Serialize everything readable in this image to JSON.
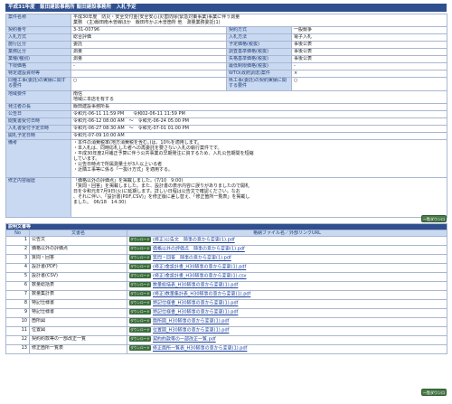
{
  "header": {
    "title": "平成31年度　飯田建設事務所 飯田建設事務所　入札予定"
  },
  "info": {
    "rows": [
      {
        "label": "案件名称",
        "value": "平成30年度　防災・安全交付金(安全安心)災害防除(緊急対策事業)事業に伴う測量\n業務　(主)飯田南木曽線ほか　飯田市かぶ木曽箇所 他　測量業務委託(1)"
      },
      {
        "label": "契約番号",
        "value": "3-31-00796",
        "label2": "契約方式",
        "value2": "一般競争"
      },
      {
        "label": "入札方式",
        "value": "総合評価",
        "label2": "入札方法",
        "value2": "電子入札"
      },
      {
        "label": "施行区分",
        "value": "委託",
        "label2": "予定価格(税抜)",
        "value2": "事後公表"
      },
      {
        "label": "業務区分",
        "value": "測量",
        "label2": "調査基準価格(税抜)",
        "value2": "事後公表"
      },
      {
        "label": "業種(種別)",
        "value": "測量",
        "label2": "失格基準価格(税抜)",
        "value2": "事後公表"
      },
      {
        "label": "下限価格",
        "value": "-",
        "label2": "最低制限価格(税抜)",
        "value2": "-"
      },
      {
        "label": "特定建設資材等",
        "value": "",
        "label2": "WTO(政府調達)案件",
        "value2": "×"
      },
      {
        "label": "同種工事(委託)の実績に関する要件",
        "value": "○",
        "label2": "県工事(委託)の契約実績に関する要件",
        "value2": "○"
      },
      {
        "label": "地域要件",
        "value": "南信\n地域に本店を有する"
      },
      {
        "label": "発注者の長",
        "value": "飯田建設事務所長"
      },
      {
        "label": "公告日",
        "value": "令和元-06-11 11:59 PM　　令和02-06-11 11:59 PM"
      },
      {
        "label": "閲覧書受付日時",
        "value": "令和元-06-12 08:00 AM　～　令和元-06-24 05:00 PM"
      },
      {
        "label": "入札書受付予定日時",
        "value": "令和元-06-27 08:30 AM　～　令和元-07-01 01:00 PM"
      },
      {
        "label": "開札予定日時",
        "value": "令和元-07-09 10:00 AM"
      },
      {
        "label": "備考",
        "value": "・本件の消費税率(地方消費税を含む。)は、10％を適用します。\n・本入札は、同時応札した者への再委託を要さない入札の執行案件です。\n・平成30年度2月補正予算に伴う公共事業の早期発注に資するため、入札公告期間を短縮\nしています。\n・公告日時点で所属測量士が3人以上いる者\n・近隣工事等に係る「一抜け方式」を適用する。"
      },
      {
        "label": "修正内容履歴",
        "value": "「価格以外の評価点」を掲載しました。(7/10　9:00)\n「質問・回答」を掲載しました。また、設計書の表示内容に誤りがありましたので開札\n日を令和元年7月9日(火)に延期します。詳しい日程は公告文で確認ください。なお\n、それに伴い、「設計書(PDF,CSV)」を修正版に差し替え、「修正箇所一覧表」を掲載し\nました。　06/18　14:30)"
      }
    ]
  },
  "docs": {
    "title": "説明文書等",
    "col_no": "No",
    "col_name": "文書名",
    "col_file": "格納ファイル名／外部リンクURL",
    "download_label": "ダウンロード",
    "top_button": "一覧ダウンロード",
    "bottom_button": "一覧ダウンロード",
    "items": [
      {
        "no": "1",
        "name": "公告文",
        "file": "(修正)公告文　随事の意から変更(1).pdf"
      },
      {
        "no": "2",
        "name": "価格以外の評価点",
        "file": "価格以外の評価点　随事の意から変更(1).pdf"
      },
      {
        "no": "3",
        "name": "質問・回答",
        "file": "質問・回答　随事の意から変更(1).pdf"
      },
      {
        "no": "4",
        "name": "設計書(PDF)",
        "file": "(修正)金設計書_H30随事の意から変更(1).pdf"
      },
      {
        "no": "5",
        "name": "設計書(CSV)",
        "file": "(修正)金設計書_H30随事の意から変更(1).csv"
      },
      {
        "no": "6",
        "name": "数量総括表",
        "file": "数量総括表_H30随事の意から変更(1).pdf"
      },
      {
        "no": "7",
        "name": "数量集計表",
        "file": "(修正)数量集計表_H30随事の意から変更(1).pdf"
      },
      {
        "no": "8",
        "name": "特記仕様書",
        "file": "特記仕様書_H30随事の意から変更(1).pdf"
      },
      {
        "no": "9",
        "name": "特記仕様書",
        "file": "特記仕様書_H30随事の意から変更(1).pdf"
      },
      {
        "no": "10",
        "name": "箇所図",
        "file": "箇所図_H30随事の意から変更(1).pdf"
      },
      {
        "no": "11",
        "name": "位置図",
        "file": "位置図_H30随事の意から変更(1).pdf"
      },
      {
        "no": "12",
        "name": "契約約款等の一部改正一覧",
        "file": "契約約款等の一部改正一覧.pdf"
      },
      {
        "no": "13",
        "name": "修正箇所一覧表",
        "file": "修正箇所一覧表_H30随事の意から変更(1).pdf"
      }
    ]
  }
}
